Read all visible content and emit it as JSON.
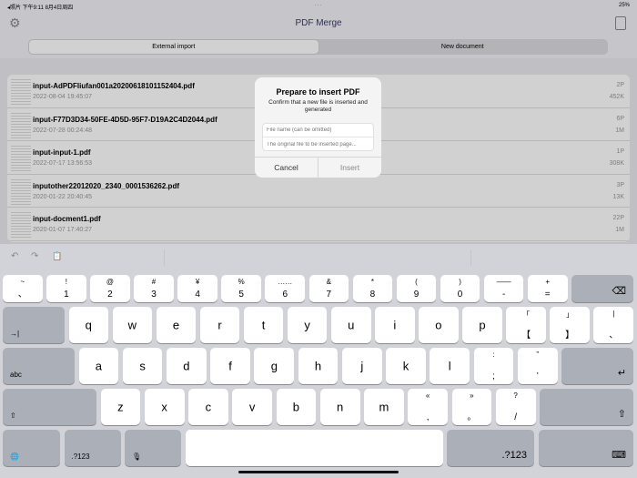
{
  "status": {
    "left": "◂照片  下午9:11  8月4日周四",
    "center": "···",
    "right": "25%"
  },
  "nav": {
    "title": "PDF Merge"
  },
  "segments": [
    "External import",
    "New document"
  ],
  "files": [
    {
      "name": "input-AdPDFliufan001a20200618101152404.pdf",
      "date": "2022-08-04 19:45:07",
      "pages": "2P",
      "size": "452K"
    },
    {
      "name": "input-F77D3D34-50FE-4D5D-95F7-D19A2C4D2044.pdf",
      "date": "2022-07-28 00:24:48",
      "pages": "6P",
      "size": "1M"
    },
    {
      "name": "input-input-1.pdf",
      "date": "2022-07-17 13:56:53",
      "pages": "1P",
      "size": "308K"
    },
    {
      "name": "inputother22012020_2340_0001536262.pdf",
      "date": "2020-01-22 20:40:45",
      "pages": "3P",
      "size": "13K"
    },
    {
      "name": "input-docment1.pdf",
      "date": "2020-01-07 17:40:27",
      "pages": "22P",
      "size": "1M"
    }
  ],
  "dialog": {
    "title": "Prepare to insert PDF",
    "message": "Confirm that a new file is inserted and generated",
    "name_placeholder": "File name (can be omitted)",
    "page_placeholder": "The original file to be inserted page...",
    "cancel": "Cancel",
    "insert": "Insert"
  },
  "keyboard": {
    "row1": [
      [
        "~",
        "、"
      ],
      [
        "!",
        "1"
      ],
      [
        "@",
        "2"
      ],
      [
        "#",
        "3"
      ],
      [
        "¥",
        "4"
      ],
      [
        "%",
        "5"
      ],
      [
        "……",
        "6"
      ],
      [
        "&",
        "7"
      ],
      [
        "*",
        "8"
      ],
      [
        "(",
        "9"
      ],
      [
        ")",
        "0"
      ],
      [
        "——",
        "-"
      ],
      [
        "+",
        "="
      ]
    ],
    "row2": [
      "q",
      "w",
      "e",
      "r",
      "t",
      "y",
      "u",
      "i",
      "o",
      "p",
      [
        "「",
        "【"
      ],
      [
        "」",
        "】"
      ],
      [
        "|",
        "、"
      ]
    ],
    "row3": [
      "a",
      "s",
      "d",
      "f",
      "g",
      "h",
      "j",
      "k",
      "l",
      [
        ":",
        ";"
      ],
      [
        "”",
        "’"
      ]
    ],
    "row4": [
      "z",
      "x",
      "c",
      "v",
      "b",
      "n",
      "m",
      [
        "«",
        ","
      ],
      [
        "»",
        "。"
      ],
      [
        "?",
        "/"
      ]
    ],
    "tab": "→|",
    "abc": "abc",
    "num": ".?123",
    "delete": "⌫",
    "return": "↵",
    "shift": "⇧",
    "globe": "🌐",
    "mic": "🎙",
    "hide": "⌨",
    "undo": "↶",
    "redo": "↷",
    "paste": "📋"
  }
}
